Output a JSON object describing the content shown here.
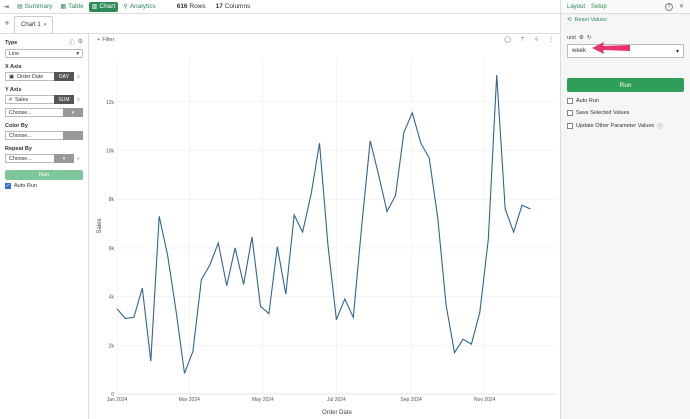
{
  "topbar": {
    "tabs": [
      {
        "label": "Summary",
        "active": false
      },
      {
        "label": "Table",
        "active": false
      },
      {
        "label": "Chart",
        "active": true
      },
      {
        "label": "Analytics",
        "active": false
      }
    ],
    "rows_count": "616",
    "rows_label": "Rows",
    "cols_count": "17",
    "cols_label": "Columns"
  },
  "sheet": {
    "name": "Chart 1"
  },
  "left": {
    "type_label": "Type",
    "type_value": "Line",
    "xaxis_label": "X Axis",
    "xaxis_field": "Order Date",
    "xaxis_agg": "DAY",
    "yaxis_label": "Y Axis",
    "yaxis_field": "Sales",
    "yaxis_agg": "SUM",
    "choose": "Choose...",
    "colorby_label": "Color By",
    "repeatby_label": "Repeat By",
    "run": "Run",
    "autorun": "Auto Run"
  },
  "chart": {
    "filter_label": "Filter"
  },
  "right": {
    "layout": "Layout",
    "setup": "Setup",
    "reset": "Reset Values",
    "param_label": "unit",
    "param_value": "week",
    "run": "Run",
    "auto_run": "Auto Run",
    "save_selected": "Save Selected Values",
    "update_other": "Update Other Parameter Values"
  },
  "colors": {
    "accent": "#2e8b57",
    "line": "#2f6690",
    "arrow": "#e8336d"
  },
  "chart_data": {
    "type": "line",
    "title": "",
    "xlabel": "Order Date",
    "ylabel": "Sales",
    "ylim": [
      0,
      13800
    ],
    "xlim": [
      "2024-01-01",
      "2024-12-31"
    ],
    "xticks": [
      "Jan 2024",
      "Mar 2024",
      "May 2024",
      "Jul 2024",
      "Sep 2024",
      "Nov 2024"
    ],
    "yticks": [
      "0",
      "2k",
      "4k",
      "6k",
      "8k",
      "10k",
      "12k"
    ],
    "x": [
      "2024-01-01",
      "2024-01-08",
      "2024-01-15",
      "2024-01-22",
      "2024-01-29",
      "2024-02-05",
      "2024-02-12",
      "2024-02-19",
      "2024-02-26",
      "2024-03-04",
      "2024-03-11",
      "2024-03-18",
      "2024-03-25",
      "2024-04-01",
      "2024-04-08",
      "2024-04-15",
      "2024-04-22",
      "2024-04-29",
      "2024-05-06",
      "2024-05-13",
      "2024-05-20",
      "2024-05-27",
      "2024-06-03",
      "2024-06-10",
      "2024-06-17",
      "2024-06-24",
      "2024-07-01",
      "2024-07-08",
      "2024-07-15",
      "2024-07-22",
      "2024-07-29",
      "2024-08-05",
      "2024-08-12",
      "2024-08-19",
      "2024-08-26",
      "2024-09-02",
      "2024-09-09",
      "2024-09-16",
      "2024-09-23",
      "2024-09-30",
      "2024-10-07",
      "2024-10-14",
      "2024-10-21",
      "2024-10-28",
      "2024-11-04",
      "2024-11-11",
      "2024-11-18",
      "2024-11-25",
      "2024-12-02",
      "2024-12-09"
    ],
    "series": [
      {
        "values": [
          3500,
          3100,
          3150,
          4350,
          1350,
          7300,
          5700,
          3400,
          850,
          1750,
          4700,
          5300,
          6200,
          4450,
          6000,
          4500,
          6450,
          3600,
          3300,
          6050,
          4100,
          7350,
          6650,
          8200,
          10300,
          6100,
          3050,
          3900,
          3150,
          6900,
          10400,
          9000,
          7500,
          8150,
          10750,
          11550,
          10300,
          9700,
          7250,
          3650,
          1700,
          2250,
          2050,
          3350,
          6350,
          13100,
          7600,
          6650,
          7750,
          7600
        ]
      }
    ]
  }
}
